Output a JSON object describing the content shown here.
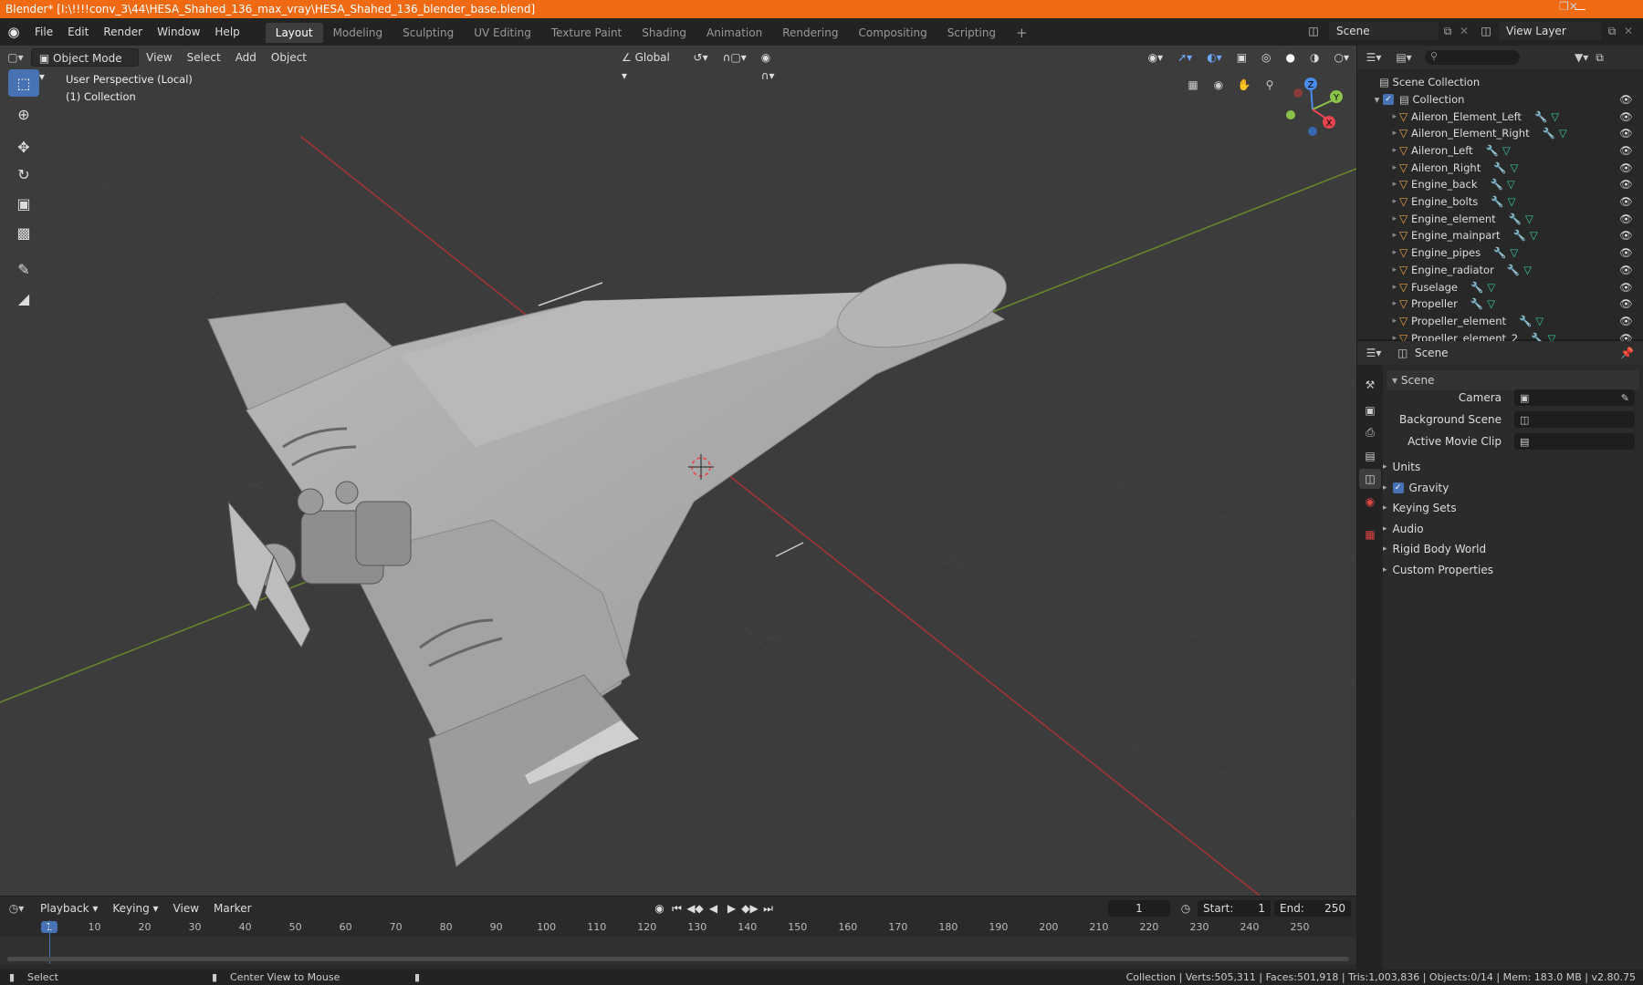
{
  "titlebar": {
    "title": "Blender* [I:\\!!!!conv_3\\44\\HESA_Shahed_136_max_vray\\HESA_Shahed_136_blender_base.blend]"
  },
  "menu": [
    "File",
    "Edit",
    "Render",
    "Window",
    "Help"
  ],
  "workspaces": [
    "Layout",
    "Modeling",
    "Sculpting",
    "UV Editing",
    "Texture Paint",
    "Shading",
    "Animation",
    "Rendering",
    "Compositing",
    "Scripting"
  ],
  "scene_name": "Scene",
  "view_layer": "View Layer",
  "viewport": {
    "mode": "Object Mode",
    "menus": [
      "View",
      "Select",
      "Add",
      "Object"
    ],
    "orientation": "Global",
    "overlay_line1": "User Perspective (Local)",
    "overlay_line2": "(1) Collection",
    "axes": {
      "x": "X",
      "y": "Y",
      "z": "Z"
    }
  },
  "outliner": {
    "root": "Scene Collection",
    "collection": "Collection",
    "items": [
      "Aileron_Element_Left",
      "Aileron_Element_Right",
      "Aileron_Left",
      "Aileron_Right",
      "Engine_back",
      "Engine_bolts",
      "Engine_element",
      "Engine_mainpart",
      "Engine_pipes",
      "Engine_radiator",
      "Fuselage",
      "Propeller",
      "Propeller_element",
      "Propeller_element_2"
    ]
  },
  "properties": {
    "header": "Scene",
    "panel": "Scene",
    "fields": {
      "camera": "Camera",
      "background_scene": "Background Scene",
      "active_movie_clip": "Active Movie Clip"
    },
    "sections": [
      "Units",
      "Gravity",
      "Keying Sets",
      "Audio",
      "Rigid Body World",
      "Custom Properties"
    ]
  },
  "timeline": {
    "menus": [
      "Playback",
      "Keying",
      "View",
      "Marker"
    ],
    "current_frame": "1",
    "start_label": "Start:",
    "start": "1",
    "end_label": "End:",
    "end": "250",
    "ticks": [
      "1",
      "10",
      "20",
      "30",
      "40",
      "50",
      "60",
      "70",
      "80",
      "90",
      "100",
      "110",
      "120",
      "130",
      "140",
      "150",
      "160",
      "170",
      "180",
      "190",
      "200",
      "210",
      "220",
      "230",
      "240",
      "250"
    ]
  },
  "statusbar": {
    "left": "Select",
    "middle": "Center View to Mouse",
    "right": "Collection | Verts:505,311 | Faces:501,918 | Tris:1,003,836 | Objects:0/14 | Mem: 183.0 MB | v2.80.75"
  },
  "colors": {
    "title_bar": "#f06a14",
    "accent": "#4772b3",
    "mesh_icon": "#e8a33d",
    "modifier_icon": "#6fa8ff",
    "data_icon": "#35c9a5",
    "axis_x": "#e84550",
    "axis_y": "#8bc34a",
    "axis_z": "#4a8ce8"
  }
}
